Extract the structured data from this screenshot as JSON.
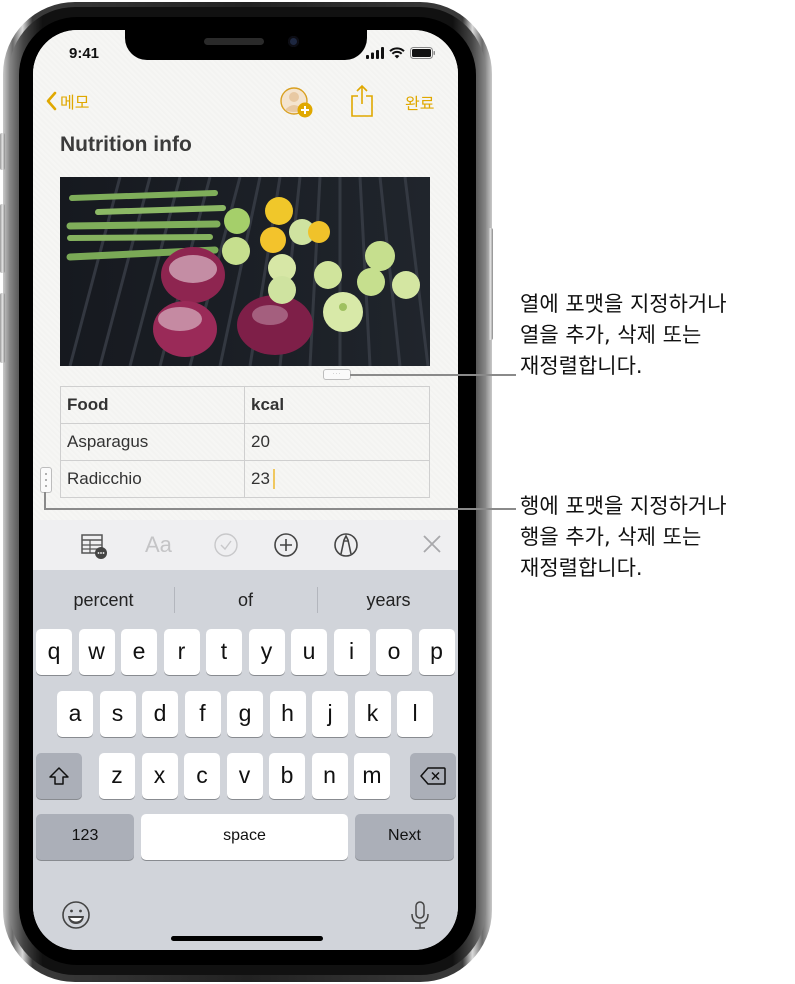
{
  "status_bar": {
    "time": "9:41",
    "icons": [
      "cellular-signal-icon",
      "wifi-icon",
      "battery-icon"
    ]
  },
  "nav": {
    "back_label": "메모",
    "done_label": "완료",
    "icons": [
      "chevron-left-icon",
      "add-person-icon",
      "share-icon"
    ]
  },
  "note": {
    "title": "Nutrition info",
    "image_description": "Grilled vegetables: asparagus, radicchio, pattypan squash"
  },
  "table": {
    "columns": [
      "Food",
      "kcal"
    ],
    "rows": [
      [
        "Asparagus",
        "20"
      ],
      [
        "Radicchio",
        "23"
      ]
    ],
    "col_handle_label": "···"
  },
  "toolbar": {
    "icons": [
      "table-options-icon",
      "text-format-icon",
      "checklist-icon",
      "add-icon",
      "markup-icon",
      "close-icon"
    ]
  },
  "keyboard": {
    "suggestions": [
      "percent",
      "of",
      "years"
    ],
    "row1": [
      "q",
      "w",
      "e",
      "r",
      "t",
      "y",
      "u",
      "i",
      "o",
      "p"
    ],
    "row2": [
      "a",
      "s",
      "d",
      "f",
      "g",
      "h",
      "j",
      "k",
      "l"
    ],
    "row3": [
      "z",
      "x",
      "c",
      "v",
      "b",
      "n",
      "m"
    ],
    "numbers_label": "123",
    "space_label": "space",
    "next_label": "Next",
    "icons": [
      "shift-icon",
      "delete-icon",
      "emoji-icon",
      "microphone-icon"
    ]
  },
  "callouts": {
    "column": [
      "열에 포맷을 지정하거나",
      "열을 추가, 삭제 또는",
      "재정렬합니다."
    ],
    "row": [
      "행에 포맷을 지정하거나",
      "행을 추가, 삭제 또는",
      "재정렬합니다."
    ]
  },
  "colors": {
    "accent": "#e0a800",
    "keyboard_bg": "#d1d4da",
    "key_dark": "#abafb8",
    "paper": "#f6f6f4"
  }
}
